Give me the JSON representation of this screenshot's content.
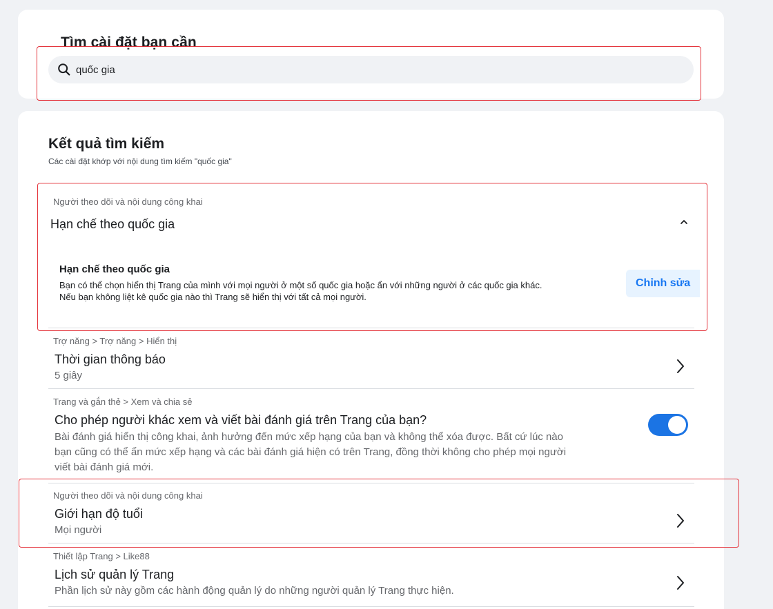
{
  "search": {
    "title": "Tìm cài đặt bạn cần",
    "query": "quốc gia",
    "icon": "search-icon"
  },
  "results": {
    "title": "Kết quả tìm kiếm",
    "subtitle": "Các cài đặt khớp với nội dung tìm kiếm \"quốc gia\"",
    "expanded": {
      "crumb": "Người theo dõi và nội dung công khai",
      "title": "Hạn chế theo quốc gia",
      "inner_title": "Hạn chế theo quốc gia",
      "inner_desc_line1": "Bạn có thể chọn hiển thị Trang của mình với mọi người ở một số quốc gia hoặc ẩn với những người ở các quốc gia khác.",
      "inner_desc_line2": "Nếu bạn không liệt kê quốc gia nào thì Trang sẽ hiển thị với tất cả mọi người.",
      "edit_label": "Chỉnh sửa"
    },
    "items": [
      {
        "crumb": "Trợ năng > Trợ năng > Hiển thị",
        "title": "Thời gian thông báo",
        "value": "5 giây"
      },
      {
        "crumb": "Trang và gắn thẻ > Xem và chia sẻ",
        "title": "Cho phép người khác xem và viết bài đánh giá trên Trang của bạn?",
        "value_line1": "Bài đánh giá hiển thị công khai, ảnh hưởng đến mức xếp hạng của bạn và không thể xóa được. Bất cứ lúc nào",
        "value_line2": "bạn cũng có thể ẩn mức xếp hạng và các bài đánh giá hiện có trên Trang, đồng thời không cho phép mọi người",
        "value_line3": "viết bài đánh giá mới.",
        "toggle_on": true
      },
      {
        "crumb": "Người theo dõi và nội dung công khai",
        "title": "Giới hạn độ tuổi",
        "value": "Mọi người"
      },
      {
        "crumb": "Thiết lập Trang > Like88",
        "title": "Lịch sử quản lý Trang",
        "value": "Phần lịch sử này gồm các hành động quản lý do những người quản lý Trang thực hiện."
      }
    ]
  },
  "colors": {
    "accent": "#1b74e4",
    "highlight_border": "#e4343c",
    "background": "#f0f2f5"
  }
}
